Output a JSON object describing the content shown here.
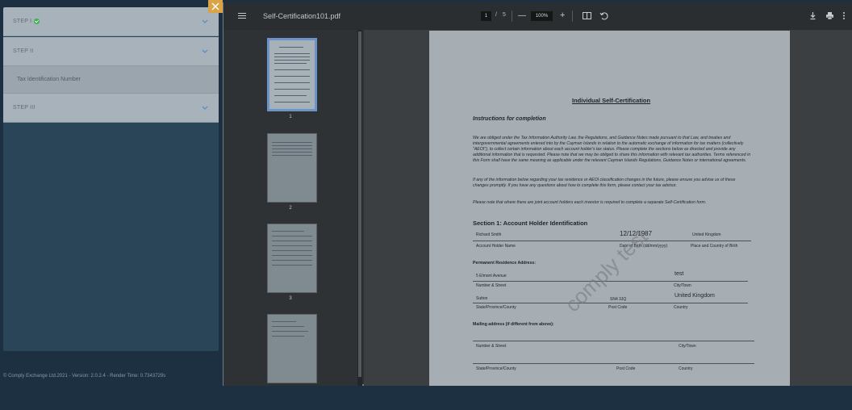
{
  "wizard": {
    "step1": {
      "label": "STEP I",
      "status_icon": "check-circle-icon",
      "status_color": "#36b24a"
    },
    "step2": {
      "label": "STEP II",
      "sub_item": "Tax Identification Number"
    },
    "step3": {
      "label": "STEP III"
    }
  },
  "footer": {
    "text": "© Comply Exchange Ltd.2021 - Version: 2.0.2.4 - Render Time: 0.7343729s"
  },
  "viewer": {
    "title": "Self-Certification101.pdf",
    "page_current": "1",
    "page_separator": "/",
    "page_total": "5",
    "zoom": "100%",
    "zoom_out": "—",
    "zoom_in": "+",
    "thumbnails": [
      "1",
      "2",
      "3"
    ]
  },
  "document": {
    "heading": "Individual Self-Certification",
    "instructions_heading": "Instructions for completion",
    "paragraph1": "We are obliged under the Tax Information Authority Law, the Regulations, and Guidance Notes made pursuant to that Law, and treaties and intergovernmental agreements entered into by the Cayman Islands in relation to the automatic exchange of information for tax matters (collectively \"AEOI\"), to collect certain information about each account holder's tax status. Please complete the sections below as directed and provide any additional information that is requested. Please note that we may be obliged to share this information with relevant tax authorities. Terms referenced in this Form shall have the same meaning as applicable under the relevant Cayman Islands Regulations, Guidance Notes or international agreements.",
    "paragraph2": "If any of the information below regarding your tax residence or AEOI classification changes in the future, please ensure you advise us of these changes promptly. If you have any questions about how to complete this form, please contact your tax advisor.",
    "paragraph3": "Please note that where there are joint account holders each investor is required to complete a separate Self-Certification form.",
    "section1_title": "Section 1: Account Holder Identification",
    "account_holder_name": "Richard Smith",
    "date_of_birth": "12/12/1987",
    "place_of_birth": "United Kingdom",
    "label_account_holder_name": "Account Holder Name",
    "label_dob": "Date of Birth (dd/mm/yyyy)",
    "label_place_of_birth": "Place and Country of Birth",
    "permanent_address_label": "Permanent Residence Address:",
    "street": "5 Elmont Avenue",
    "city": "test",
    "label_street": "Number & Street",
    "label_city": "City/Town",
    "state": "Sutton",
    "post_code": "SN4 3JQ",
    "country": "United Kingdom",
    "label_state": "State/Province/County",
    "label_post_code": "Post Code",
    "label_country": "Country",
    "mailing_address_label": "Mailing address (if different from above):",
    "label_street2": "Number & Street",
    "label_city2": "City/Town",
    "label_state2": "State/Province/County",
    "label_post_code2": "Post Code",
    "label_country2": "Country",
    "watermark": "comply test"
  }
}
